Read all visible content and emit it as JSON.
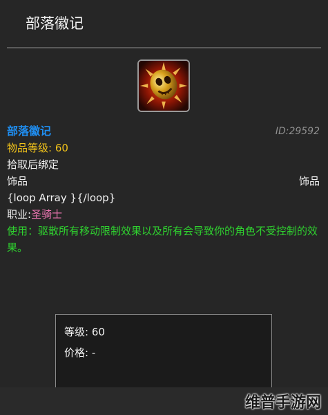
{
  "header": {
    "title": "部落徽记"
  },
  "item": {
    "name": "部落徽记",
    "id_label": "ID:29592",
    "item_level": "物品等级: 60",
    "binding": "拾取后绑定",
    "slot_left": "饰品",
    "slot_right": "饰品",
    "loop_text": "{loop Array }{/loop}",
    "class_label": "职业:",
    "class_name": "圣骑士",
    "use_effect": "使用：驱散所有移动限制效果以及所有会导致你的角色不受控制的效果。"
  },
  "stats": {
    "level": "等级: 60",
    "price": "价格: -"
  },
  "watermark": "维普手游网",
  "icon": {
    "name": "skull-trinket-icon",
    "border_color": "#9a9a9a",
    "glow_color": "#ff3b10"
  },
  "colors": {
    "name": "#1f8ef1",
    "item_level": "#f1c21a",
    "class": "#ef77b4",
    "use_effect": "#2fd12f",
    "id": "#8f8f8f"
  }
}
